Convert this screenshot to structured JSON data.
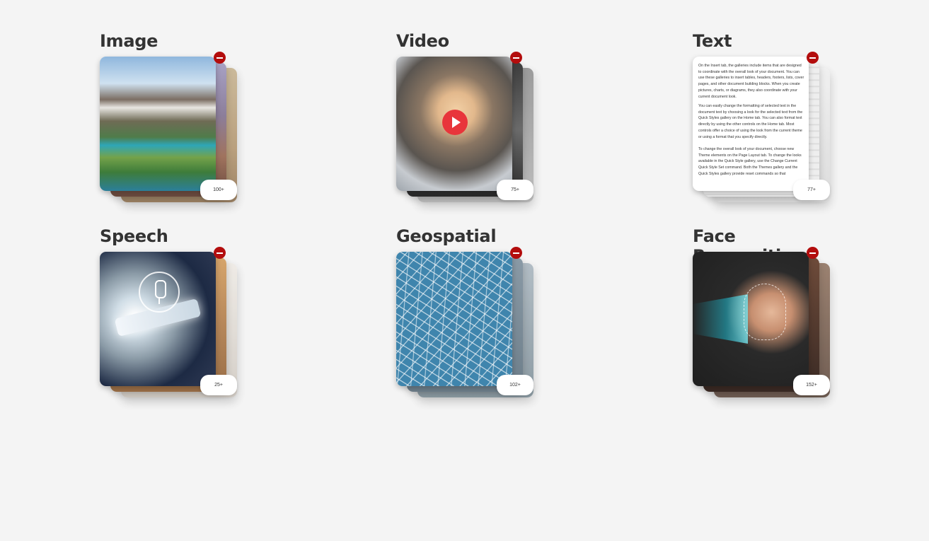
{
  "cards": [
    {
      "title": "Image",
      "count": "100+"
    },
    {
      "title": "Video",
      "count": "75+"
    },
    {
      "title": "Text",
      "count": "77+"
    },
    {
      "title": "Speech",
      "count": "25+"
    },
    {
      "title": "Geospatial",
      "count": "102+"
    },
    {
      "title": "Face Recognition",
      "count": "152+"
    }
  ],
  "text_preview": {
    "p1": "On the Insert tab, the galleries include items that are designed to coordinate with the overall look of your document. You can use these galleries to insert tables, headers, footers, lists, cover pages, and other document building blocks. When you create pictures, charts, or diagrams, they also coordinate with your current document look.",
    "p2": "You can easily change the formatting of selected text in the document text by choosing a look for the selected text from the Quick Styles gallery on the Home tab. You can also format text directly by using the other controls on the Home tab. Most controls offer a choice of using the look from the current theme or using a format that you specify directly.",
    "p3": "To change the overall look of your document, choose new Theme elements on the Page Layout tab. To change the looks available in the Quick Style gallery, use the Change Current Quick Style Set command. Both the Themes gallery and the Quick Styles gallery provide reset commands so that"
  },
  "colors": {
    "background": "#f4f4f4",
    "remove": "#b30d0d",
    "play": "#e8353b",
    "map": "#3f85ad"
  },
  "icons": [
    "remove-icon",
    "play-icon",
    "microphone-icon"
  ]
}
